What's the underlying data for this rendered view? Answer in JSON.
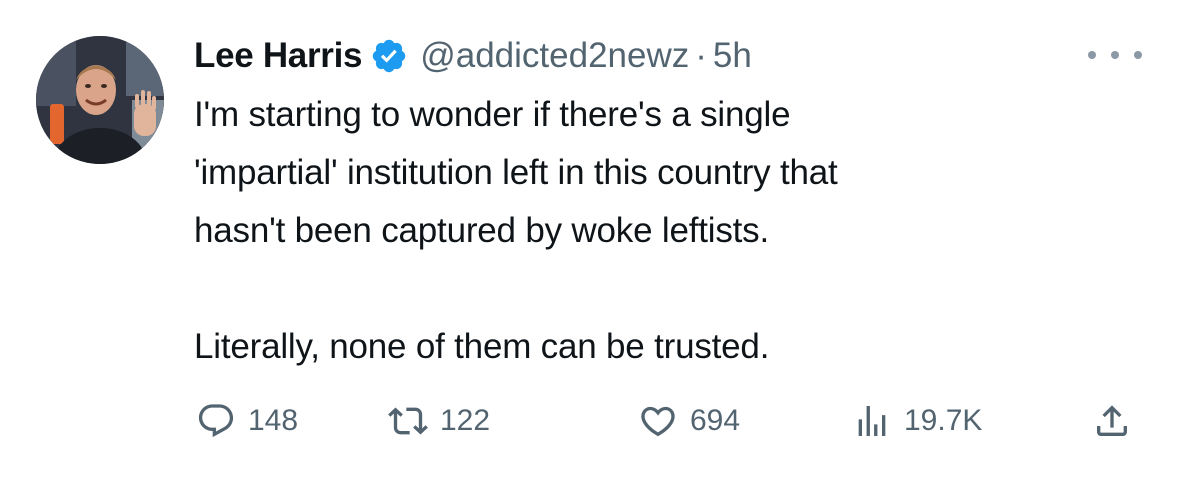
{
  "author": {
    "name": "Lee Harris",
    "handle": "@addicted2newz",
    "separator": "·",
    "time": "5h",
    "verified": true
  },
  "tweet": {
    "lines": [
      "I'm starting to wonder if there's a single",
      "'impartial' institution left in this country that",
      "hasn't been captured by woke leftists."
    ],
    "second_paragraph": "Literally, none of them can be trusted."
  },
  "actions": {
    "replies": "148",
    "retweets": "122",
    "likes": "694",
    "views": "19.7K"
  },
  "icons": {
    "reply": "reply-icon",
    "retweet": "retweet-icon",
    "like": "heart-icon",
    "views": "views-chart-icon",
    "share": "share-icon",
    "more": "more-dots-icon",
    "verified": "verified-badge-icon"
  },
  "colors": {
    "text": "#0f1419",
    "secondary": "#536471",
    "verified": "#1d9bf0"
  }
}
